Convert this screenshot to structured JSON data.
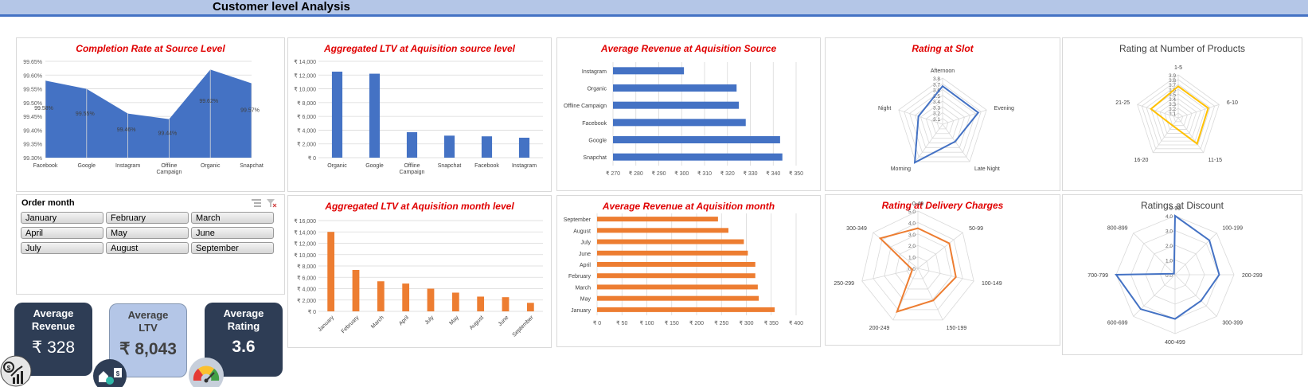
{
  "header": {
    "title": "Customer level Analysis"
  },
  "colors": {
    "blue": "#4472c4",
    "orange": "#ed7d31",
    "gold": "#ffc000",
    "red": "#e00000",
    "navy": "#2e3d55",
    "light_kpi": "#b4c6e7"
  },
  "slicer": {
    "title": "Order month",
    "items": [
      "January",
      "February",
      "March",
      "April",
      "May",
      "June",
      "July",
      "August",
      "September"
    ],
    "icons": [
      "multi-select-icon",
      "clear-filter-icon"
    ]
  },
  "kpis": [
    {
      "label_line1": "Average",
      "label_line2": "Revenue",
      "value": "₹ 328",
      "icon": "revenue-growth-icon"
    },
    {
      "label_line1": "Average",
      "label_line2": "LTV",
      "value": "₹ 8,043",
      "icon": "customer-money-icon"
    },
    {
      "label_line1": "Average",
      "label_line2": "Rating",
      "value": "3.6",
      "icon": "rating-gauge-icon"
    }
  ],
  "chart_data": [
    {
      "id": "completion",
      "type": "area",
      "title": "Completion Rate at Source Level",
      "categories": [
        "Facebook",
        "Google",
        "Instagram",
        "Offline Campaign",
        "Organic",
        "Snapchat"
      ],
      "values": [
        99.58,
        99.55,
        99.46,
        99.44,
        99.62,
        99.57
      ],
      "data_labels": [
        "99.58%",
        "99.55%",
        "99.46%",
        "99.44%",
        "99.62%",
        "99.57%"
      ],
      "yticks": [
        "99.30%",
        "99.35%",
        "99.40%",
        "99.45%",
        "99.50%",
        "99.55%",
        "99.60%",
        "99.65%"
      ],
      "ylim": [
        99.3,
        99.65
      ]
    },
    {
      "id": "ltv_source",
      "type": "bar",
      "title": "Aggregated LTV at Aquisition source level",
      "categories": [
        "Organic",
        "Google",
        "Offline Campaign",
        "Snapchat",
        "Facebook",
        "Instagram"
      ],
      "values": [
        12500,
        12200,
        3700,
        3200,
        3100,
        2900
      ],
      "yticks": [
        "₹ 0",
        "₹ 2,000",
        "₹ 4,000",
        "₹ 6,000",
        "₹ 8,000",
        "₹ 10,000",
        "₹ 12,000",
        "₹ 14,000"
      ],
      "ylim": [
        0,
        14000
      ]
    },
    {
      "id": "rev_source",
      "type": "hbar",
      "title": "Average Revenue at Aquisition Source",
      "categories": [
        "Instagram",
        "Organic",
        "Offline Campaign",
        "Facebook",
        "Google",
        "Snapchat"
      ],
      "values": [
        301,
        324,
        325,
        328,
        343,
        344
      ],
      "xticks": [
        "₹ 270",
        "₹ 280",
        "₹ 290",
        "₹ 300",
        "₹ 310",
        "₹ 320",
        "₹ 330",
        "₹ 340",
        "₹ 350"
      ],
      "xlim": [
        270,
        350
      ]
    },
    {
      "id": "slot",
      "type": "radar",
      "title": "Rating at Slot",
      "categories": [
        "Afternoon",
        "Evening",
        "Late Night",
        "Morning",
        "Night"
      ],
      "values": [
        3.66,
        3.65,
        3.37,
        3.82,
        3.44
      ],
      "ticks": [
        "3.1",
        "3.2",
        "3.3",
        "3.4",
        "3.5",
        "3.6",
        "3.7",
        "3.8"
      ],
      "range": [
        3.0,
        3.8
      ]
    },
    {
      "id": "products",
      "type": "radar",
      "title": "Rating at Number of Products",
      "categories": [
        "1-5",
        "6-10",
        "11-15",
        "16-20",
        "21-25"
      ],
      "values": [
        3.66,
        3.66,
        3.67,
        3.2,
        3.6
      ],
      "ticks": [
        "3.1",
        "3.2",
        "3.3",
        "3.4",
        "3.5",
        "3.6",
        "3.7",
        "3.8",
        "3.9"
      ],
      "range": [
        3.0,
        3.9
      ]
    },
    {
      "id": "ltv_month",
      "type": "bar",
      "title": "Aggregated LTV at Aquisition month level",
      "categories": [
        "January",
        "February",
        "March",
        "April",
        "July",
        "May",
        "August",
        "June",
        "September"
      ],
      "values": [
        14000,
        7300,
        5300,
        4900,
        4000,
        3300,
        2600,
        2500,
        1500
      ],
      "yticks": [
        "₹ 0",
        "₹ 2,000",
        "₹ 4,000",
        "₹ 6,000",
        "₹ 8,000",
        "₹ 10,000",
        "₹ 12,000",
        "₹ 14,000",
        "₹ 16,000"
      ],
      "ylim": [
        0,
        16000
      ]
    },
    {
      "id": "rev_month",
      "type": "hbar",
      "title": "Average Revenue at Aquisition month",
      "categories": [
        "September",
        "August",
        "July",
        "June",
        "April",
        "February",
        "March",
        "May",
        "January"
      ],
      "values": [
        243,
        264,
        295,
        303,
        318,
        318,
        323,
        325,
        357
      ],
      "xticks": [
        "₹ 0",
        "₹ 50",
        "₹ 100",
        "₹ 150",
        "₹ 200",
        "₹ 250",
        "₹ 300",
        "₹ 350",
        "₹ 400"
      ],
      "xlim": [
        0,
        400
      ]
    },
    {
      "id": "delivery",
      "type": "radar",
      "title": "Rating at Delivery Charges",
      "categories": [
        "0-49",
        "50-99",
        "100-149",
        "150-199",
        "200-249",
        "250-299",
        "300-349"
      ],
      "values": [
        3.5,
        3.5,
        3.4,
        3.1,
        4.2,
        0.5,
        4.2
      ],
      "ticks": [
        "0.0",
        "1.0",
        "2.0",
        "3.0",
        "4.0",
        "5.0"
      ],
      "range": [
        0,
        5
      ]
    },
    {
      "id": "discount",
      "type": "radar",
      "title": "Ratings at Discount",
      "categories": [
        "0-99",
        "100-199",
        "200-299",
        "300-399",
        "400-499",
        "600-699",
        "700-799",
        "800-899"
      ],
      "values": [
        4.0,
        3.3,
        3.0,
        2.5,
        3.0,
        3.3,
        4.0,
        0.1
      ],
      "ticks": [
        "0.0",
        "1.0",
        "2.0",
        "3.0",
        "4.0"
      ],
      "range": [
        0,
        4
      ]
    }
  ]
}
